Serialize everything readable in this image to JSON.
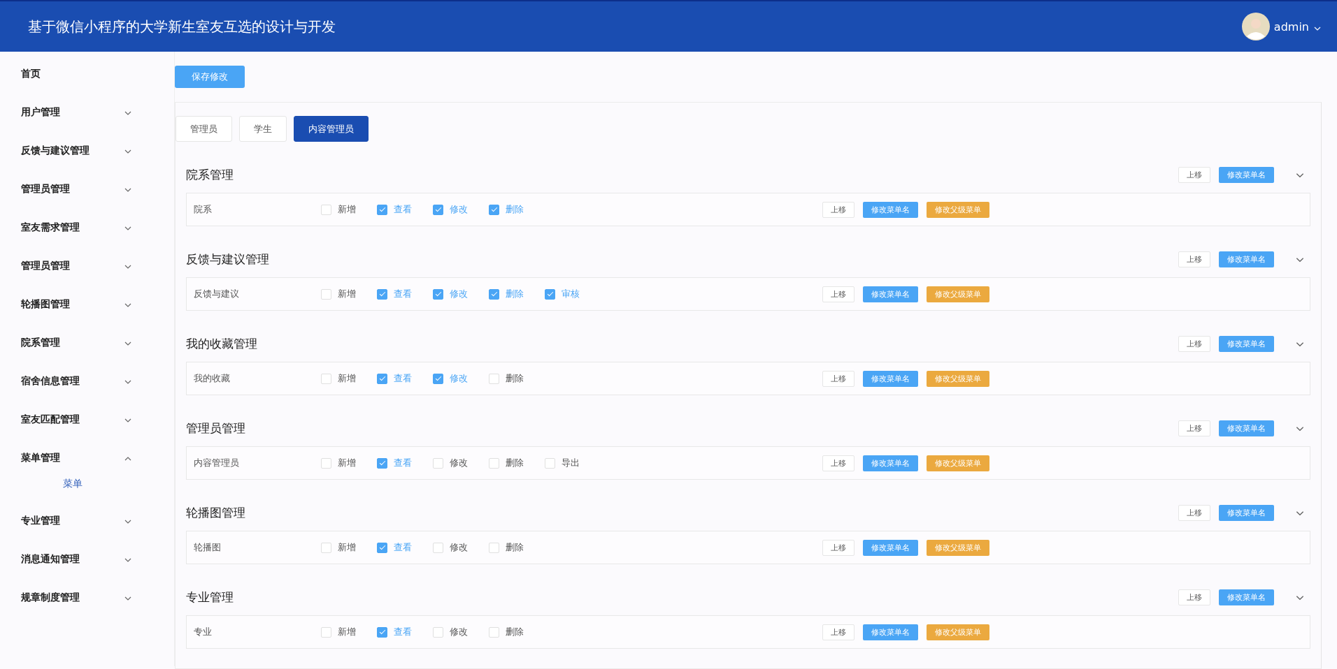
{
  "header": {
    "title": "基于微信小程序的大学新生室友互选的设计与开发",
    "user": "admin"
  },
  "sidebar": {
    "items": [
      {
        "label": "首页",
        "kind": "link"
      },
      {
        "label": "用户管理",
        "kind": "submenu",
        "expanded": false
      },
      {
        "label": "反馈与建议管理",
        "kind": "submenu",
        "expanded": false
      },
      {
        "label": "管理员管理",
        "kind": "submenu",
        "expanded": false
      },
      {
        "label": "室友需求管理",
        "kind": "submenu",
        "expanded": false
      },
      {
        "label": "管理员管理",
        "kind": "submenu",
        "expanded": false
      },
      {
        "label": "轮播图管理",
        "kind": "submenu",
        "expanded": false
      },
      {
        "label": "院系管理",
        "kind": "submenu",
        "expanded": false
      },
      {
        "label": "宿舍信息管理",
        "kind": "submenu",
        "expanded": false
      },
      {
        "label": "室友匹配管理",
        "kind": "submenu",
        "expanded": false
      },
      {
        "label": "菜单管理",
        "kind": "submenu",
        "expanded": true,
        "children": [
          {
            "label": "菜单",
            "selected": true
          }
        ]
      },
      {
        "label": "专业管理",
        "kind": "submenu",
        "expanded": false
      },
      {
        "label": "消息通知管理",
        "kind": "submenu",
        "expanded": false
      },
      {
        "label": "规章制度管理",
        "kind": "submenu",
        "expanded": false
      }
    ]
  },
  "save_button": "保存修改",
  "tabs": [
    {
      "label": "管理员",
      "selected": false
    },
    {
      "label": "学生",
      "selected": false
    },
    {
      "label": "内容管理员",
      "selected": true
    }
  ],
  "sections": [
    {
      "title": "院系管理",
      "actions": [
        {
          "label": "上移",
          "kind": "plain"
        },
        {
          "label": "修改菜单名",
          "kind": "primary"
        }
      ],
      "rows": [
        {
          "name": "院系",
          "permissions": [
            {
              "label": "新增",
              "checked": false
            },
            {
              "label": "查看",
              "checked": true
            },
            {
              "label": "修改",
              "checked": true
            },
            {
              "label": "删除",
              "checked": true
            }
          ],
          "actions": [
            {
              "label": "上移",
              "kind": "plain"
            },
            {
              "label": "修改菜单名",
              "kind": "primary"
            },
            {
              "label": "修改父级菜单",
              "kind": "warning"
            }
          ]
        }
      ]
    },
    {
      "title": "反馈与建议管理",
      "actions": [
        {
          "label": "上移",
          "kind": "plain"
        },
        {
          "label": "修改菜单名",
          "kind": "primary"
        }
      ],
      "rows": [
        {
          "name": "反馈与建议",
          "permissions": [
            {
              "label": "新增",
              "checked": false
            },
            {
              "label": "查看",
              "checked": true
            },
            {
              "label": "修改",
              "checked": true
            },
            {
              "label": "删除",
              "checked": true
            },
            {
              "label": "审核",
              "checked": true
            }
          ],
          "actions": [
            {
              "label": "上移",
              "kind": "plain"
            },
            {
              "label": "修改菜单名",
              "kind": "primary"
            },
            {
              "label": "修改父级菜单",
              "kind": "warning"
            }
          ]
        }
      ]
    },
    {
      "title": "我的收藏管理",
      "actions": [
        {
          "label": "上移",
          "kind": "plain"
        },
        {
          "label": "修改菜单名",
          "kind": "primary"
        }
      ],
      "rows": [
        {
          "name": "我的收藏",
          "permissions": [
            {
              "label": "新增",
              "checked": false
            },
            {
              "label": "查看",
              "checked": true
            },
            {
              "label": "修改",
              "checked": true
            },
            {
              "label": "删除",
              "checked": false
            }
          ],
          "actions": [
            {
              "label": "上移",
              "kind": "plain"
            },
            {
              "label": "修改菜单名",
              "kind": "primary"
            },
            {
              "label": "修改父级菜单",
              "kind": "warning"
            }
          ]
        }
      ]
    },
    {
      "title": "管理员管理",
      "actions": [
        {
          "label": "上移",
          "kind": "plain"
        },
        {
          "label": "修改菜单名",
          "kind": "primary"
        }
      ],
      "rows": [
        {
          "name": "内容管理员",
          "permissions": [
            {
              "label": "新增",
              "checked": false
            },
            {
              "label": "查看",
              "checked": true
            },
            {
              "label": "修改",
              "checked": false
            },
            {
              "label": "删除",
              "checked": false
            },
            {
              "label": "导出",
              "checked": false
            }
          ],
          "actions": [
            {
              "label": "上移",
              "kind": "plain"
            },
            {
              "label": "修改菜单名",
              "kind": "primary"
            },
            {
              "label": "修改父级菜单",
              "kind": "warning"
            }
          ]
        }
      ]
    },
    {
      "title": "轮播图管理",
      "actions": [
        {
          "label": "上移",
          "kind": "plain"
        },
        {
          "label": "修改菜单名",
          "kind": "primary"
        }
      ],
      "rows": [
        {
          "name": "轮播图",
          "permissions": [
            {
              "label": "新增",
              "checked": false
            },
            {
              "label": "查看",
              "checked": true
            },
            {
              "label": "修改",
              "checked": false
            },
            {
              "label": "删除",
              "checked": false
            }
          ],
          "actions": [
            {
              "label": "上移",
              "kind": "plain"
            },
            {
              "label": "修改菜单名",
              "kind": "primary"
            },
            {
              "label": "修改父级菜单",
              "kind": "warning"
            }
          ]
        }
      ]
    },
    {
      "title": "专业管理",
      "actions": [
        {
          "label": "上移",
          "kind": "plain"
        },
        {
          "label": "修改菜单名",
          "kind": "primary"
        }
      ],
      "rows": [
        {
          "name": "专业",
          "permissions": [
            {
              "label": "新增",
              "checked": false
            },
            {
              "label": "查看",
              "checked": true
            },
            {
              "label": "修改",
              "checked": false
            },
            {
              "label": "删除",
              "checked": false
            }
          ],
          "actions": [
            {
              "label": "上移",
              "kind": "plain"
            },
            {
              "label": "修改菜单名",
              "kind": "primary"
            },
            {
              "label": "修改父级菜单",
              "kind": "warning"
            }
          ]
        }
      ]
    }
  ]
}
